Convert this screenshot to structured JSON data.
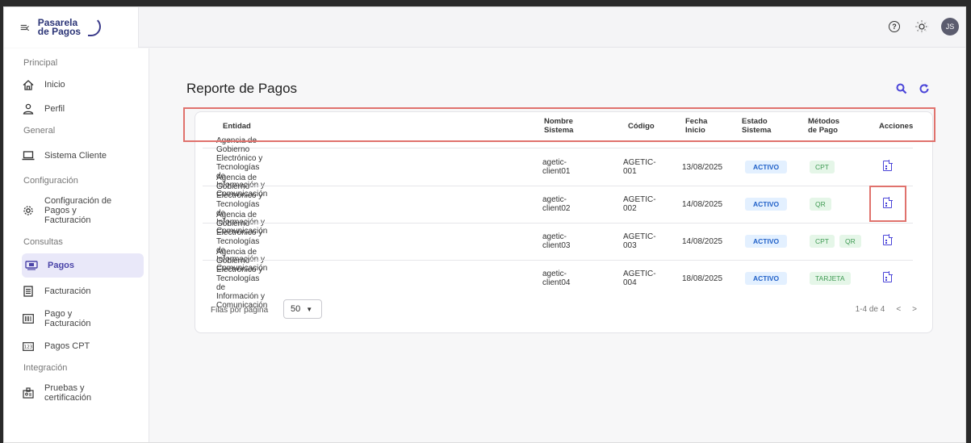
{
  "header": {
    "logo_line1": "Pasarela",
    "logo_line2": "de Pagos",
    "avatar_initials": "JS"
  },
  "sidebar": {
    "sections": [
      {
        "title": "Principal",
        "items": [
          "Inicio",
          "Perfil"
        ]
      },
      {
        "title": "General",
        "items": [
          "Sistema Cliente"
        ]
      },
      {
        "title": "Configuración",
        "items": [
          "Configuración de Pagos y Facturación"
        ]
      },
      {
        "title": "Consultas",
        "items": [
          "Pagos",
          "Facturación",
          "Pago y Facturación",
          "Pagos CPT"
        ]
      },
      {
        "title": "Integración",
        "items": [
          "Pruebas y certificación"
        ]
      }
    ],
    "labels": {
      "principal": "Principal",
      "inicio": "Inicio",
      "perfil": "Perfil",
      "general": "General",
      "sistema_cliente": "Sistema Cliente",
      "configuracion": "Configuración",
      "config_1": "Configuración de",
      "config_2": "Pagos y",
      "config_3": "Facturación",
      "consultas": "Consultas",
      "pagos": "Pagos",
      "facturacion": "Facturación",
      "pago_fact_1": "Pago y",
      "pago_fact_2": "Facturación",
      "pagos_cpt": "Pagos CPT",
      "integracion": "Integración",
      "pruebas_1": "Pruebas y",
      "pruebas_2": "certificación"
    },
    "active_item": "Pagos"
  },
  "main": {
    "title": "Reporte de Pagos",
    "table": {
      "headers": [
        "Entidad",
        "Nombre Sistema",
        "Código",
        "Fecha Inicio",
        "Estado Sistema",
        "Métodos de Pago",
        "Acciones"
      ],
      "rows": [
        {
          "entidad": "Agencia de Gobierno Electrónico y Tecnologías de Información y Comunicación",
          "sistema": "agetic-client01",
          "codigo": "AGETIC-001",
          "fecha": "13/08/2025",
          "estado": "ACTIVO",
          "metodos": [
            "CPT"
          ]
        },
        {
          "entidad": "Agencia de Gobierno Electrónico y Tecnologías de Información y Comunicación",
          "sistema": "agetic-client02",
          "codigo": "AGETIC-002",
          "fecha": "14/08/2025",
          "estado": "ACTIVO",
          "metodos": [
            "QR"
          ]
        },
        {
          "entidad": "Agencia de Gobierno Electrónico y Tecnologías de Información y Comunicación",
          "sistema": "agetic-client03",
          "codigo": "AGETIC-003",
          "fecha": "14/08/2025",
          "estado": "ACTIVO",
          "metodos": [
            "CPT",
            "QR"
          ]
        },
        {
          "entidad": "Agencia de Gobierno Electrónico y Tecnologías de Información y Comunicación",
          "sistema": "agetic-client04",
          "codigo": "AGETIC-004",
          "fecha": "18/08/2025",
          "estado": "ACTIVO",
          "metodos": [
            "TARJETA"
          ]
        }
      ]
    },
    "footer": {
      "rows_per_page_label": "Filas por página",
      "rows_per_page_value": "50",
      "range_label": "1-4 de 4"
    }
  },
  "colors": {
    "accent": "#4a44d8",
    "active_bg": "#e9e8f9",
    "badge_activo_bg": "#e3f0ff",
    "badge_activo_fg": "#2060c8",
    "badge_method_bg": "#e5f6e8",
    "badge_method_fg": "#3e9a52",
    "highlight": "#e0726d"
  },
  "icons": [
    "menu-collapse-icon",
    "help-icon",
    "theme-sun-icon",
    "home-icon",
    "user-icon",
    "laptop-icon",
    "gear-icon",
    "payments-icon",
    "invoice-icon",
    "barcode-icon",
    "cpt-icon",
    "badge-icon",
    "search-icon",
    "refresh-icon",
    "document-icon"
  ]
}
